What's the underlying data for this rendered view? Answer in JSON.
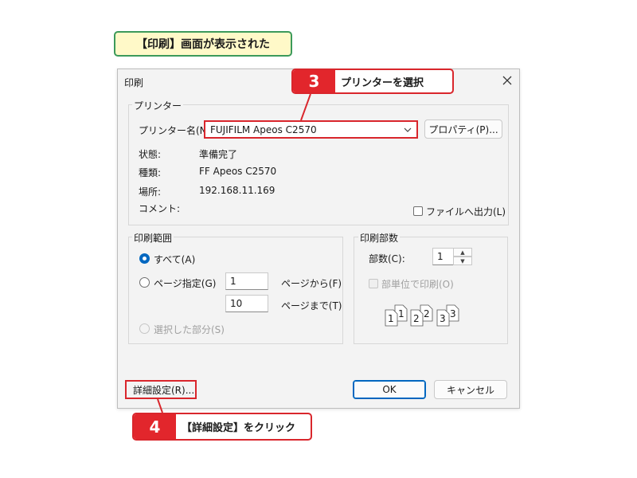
{
  "caption": "【印刷】画面が表示された",
  "dialog": {
    "title": "印刷",
    "printer_group": {
      "label": "プリンター",
      "name_label": "プリンター名(N):",
      "selected_printer": "FUJIFILM Apeos C2570",
      "properties_button": "プロパティ(P)...",
      "status_label": "状態:",
      "status_value": "準備完了",
      "type_label": "種類:",
      "type_value": "FF Apeos C2570",
      "location_label": "場所:",
      "location_value": "192.168.11.169",
      "comment_label": "コメント:",
      "print_to_file_label": "ファイルへ出力(L)"
    },
    "range_group": {
      "label": "印刷範囲",
      "all_label": "すべて(A)",
      "pages_label": "ページ指定(G)",
      "from_value": "1",
      "from_label": "ページから(F)",
      "to_value": "10",
      "to_label": "ページまで(T)",
      "selection_label": "選択した部分(S)"
    },
    "copies_group": {
      "label": "印刷部数",
      "copies_label": "部数(C):",
      "copies_value": "1",
      "collate_label": "部単位で印刷(O)",
      "collate_digits": [
        "1",
        "1",
        "2",
        "2",
        "3",
        "3"
      ]
    },
    "advanced_button": "詳細設定(R)...",
    "ok_button": "OK",
    "cancel_button": "キャンセル"
  },
  "callouts": {
    "step3": {
      "number": "3",
      "text": "プリンターを選択"
    },
    "step4": {
      "number": "4",
      "text": "【詳細設定】をクリック"
    }
  },
  "colors": {
    "accent": "#0067c0",
    "callout_red": "#e2262c",
    "caption_green": "#3c9a5a",
    "caption_bg": "#fff9c8"
  }
}
